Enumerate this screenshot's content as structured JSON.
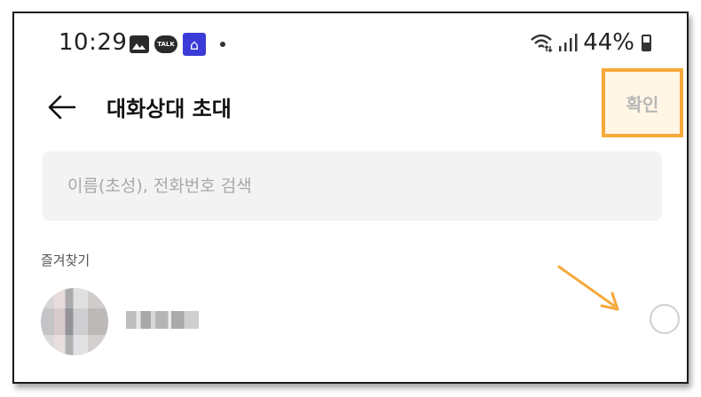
{
  "status_bar": {
    "time": "10:29",
    "talk_badge": "TALK",
    "battery": "44%",
    "icons": [
      "gallery-icon",
      "kakaotalk-icon",
      "home-app-icon",
      "notification-dot-icon",
      "wifi-icon",
      "signal-icon",
      "battery-icon"
    ]
  },
  "header": {
    "title": "대화상대 초대",
    "confirm_label": "확인",
    "back_icon": "arrow-left-icon"
  },
  "search": {
    "placeholder": "이름(초성), 전화번호 검색",
    "value": ""
  },
  "favorites": {
    "section_label": "즐겨찾기",
    "items": [
      {
        "name": "",
        "selected": false
      }
    ]
  },
  "colors": {
    "highlight_border": "#f6a93a",
    "search_bg": "#f3f3f3",
    "confirm_text": "#b8b8b8"
  }
}
